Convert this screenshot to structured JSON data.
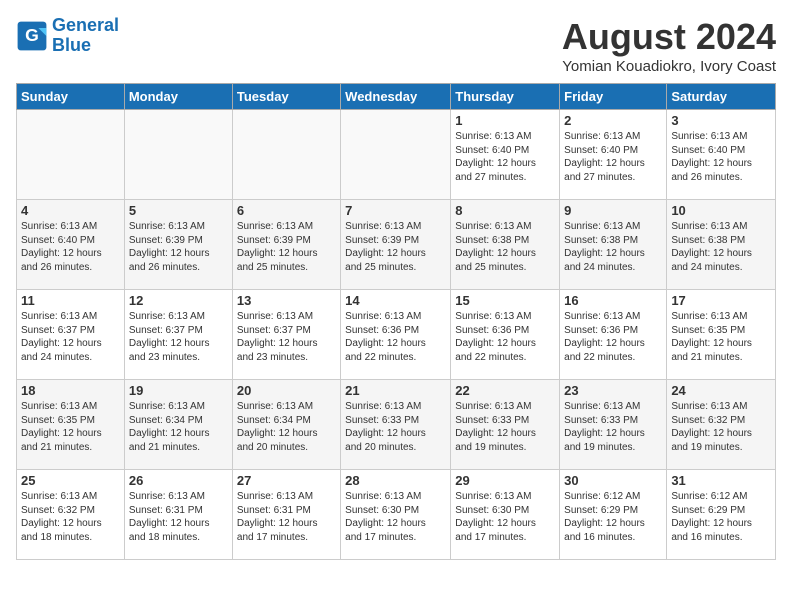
{
  "header": {
    "logo_line1": "General",
    "logo_line2": "Blue",
    "month_year": "August 2024",
    "location": "Yomian Kouadiokro, Ivory Coast"
  },
  "weekdays": [
    "Sunday",
    "Monday",
    "Tuesday",
    "Wednesday",
    "Thursday",
    "Friday",
    "Saturday"
  ],
  "weeks": [
    [
      {
        "day": "",
        "info": ""
      },
      {
        "day": "",
        "info": ""
      },
      {
        "day": "",
        "info": ""
      },
      {
        "day": "",
        "info": ""
      },
      {
        "day": "1",
        "info": "Sunrise: 6:13 AM\nSunset: 6:40 PM\nDaylight: 12 hours\nand 27 minutes."
      },
      {
        "day": "2",
        "info": "Sunrise: 6:13 AM\nSunset: 6:40 PM\nDaylight: 12 hours\nand 27 minutes."
      },
      {
        "day": "3",
        "info": "Sunrise: 6:13 AM\nSunset: 6:40 PM\nDaylight: 12 hours\nand 26 minutes."
      }
    ],
    [
      {
        "day": "4",
        "info": "Sunrise: 6:13 AM\nSunset: 6:40 PM\nDaylight: 12 hours\nand 26 minutes."
      },
      {
        "day": "5",
        "info": "Sunrise: 6:13 AM\nSunset: 6:39 PM\nDaylight: 12 hours\nand 26 minutes."
      },
      {
        "day": "6",
        "info": "Sunrise: 6:13 AM\nSunset: 6:39 PM\nDaylight: 12 hours\nand 25 minutes."
      },
      {
        "day": "7",
        "info": "Sunrise: 6:13 AM\nSunset: 6:39 PM\nDaylight: 12 hours\nand 25 minutes."
      },
      {
        "day": "8",
        "info": "Sunrise: 6:13 AM\nSunset: 6:38 PM\nDaylight: 12 hours\nand 25 minutes."
      },
      {
        "day": "9",
        "info": "Sunrise: 6:13 AM\nSunset: 6:38 PM\nDaylight: 12 hours\nand 24 minutes."
      },
      {
        "day": "10",
        "info": "Sunrise: 6:13 AM\nSunset: 6:38 PM\nDaylight: 12 hours\nand 24 minutes."
      }
    ],
    [
      {
        "day": "11",
        "info": "Sunrise: 6:13 AM\nSunset: 6:37 PM\nDaylight: 12 hours\nand 24 minutes."
      },
      {
        "day": "12",
        "info": "Sunrise: 6:13 AM\nSunset: 6:37 PM\nDaylight: 12 hours\nand 23 minutes."
      },
      {
        "day": "13",
        "info": "Sunrise: 6:13 AM\nSunset: 6:37 PM\nDaylight: 12 hours\nand 23 minutes."
      },
      {
        "day": "14",
        "info": "Sunrise: 6:13 AM\nSunset: 6:36 PM\nDaylight: 12 hours\nand 22 minutes."
      },
      {
        "day": "15",
        "info": "Sunrise: 6:13 AM\nSunset: 6:36 PM\nDaylight: 12 hours\nand 22 minutes."
      },
      {
        "day": "16",
        "info": "Sunrise: 6:13 AM\nSunset: 6:36 PM\nDaylight: 12 hours\nand 22 minutes."
      },
      {
        "day": "17",
        "info": "Sunrise: 6:13 AM\nSunset: 6:35 PM\nDaylight: 12 hours\nand 21 minutes."
      }
    ],
    [
      {
        "day": "18",
        "info": "Sunrise: 6:13 AM\nSunset: 6:35 PM\nDaylight: 12 hours\nand 21 minutes."
      },
      {
        "day": "19",
        "info": "Sunrise: 6:13 AM\nSunset: 6:34 PM\nDaylight: 12 hours\nand 21 minutes."
      },
      {
        "day": "20",
        "info": "Sunrise: 6:13 AM\nSunset: 6:34 PM\nDaylight: 12 hours\nand 20 minutes."
      },
      {
        "day": "21",
        "info": "Sunrise: 6:13 AM\nSunset: 6:33 PM\nDaylight: 12 hours\nand 20 minutes."
      },
      {
        "day": "22",
        "info": "Sunrise: 6:13 AM\nSunset: 6:33 PM\nDaylight: 12 hours\nand 19 minutes."
      },
      {
        "day": "23",
        "info": "Sunrise: 6:13 AM\nSunset: 6:33 PM\nDaylight: 12 hours\nand 19 minutes."
      },
      {
        "day": "24",
        "info": "Sunrise: 6:13 AM\nSunset: 6:32 PM\nDaylight: 12 hours\nand 19 minutes."
      }
    ],
    [
      {
        "day": "25",
        "info": "Sunrise: 6:13 AM\nSunset: 6:32 PM\nDaylight: 12 hours\nand 18 minutes."
      },
      {
        "day": "26",
        "info": "Sunrise: 6:13 AM\nSunset: 6:31 PM\nDaylight: 12 hours\nand 18 minutes."
      },
      {
        "day": "27",
        "info": "Sunrise: 6:13 AM\nSunset: 6:31 PM\nDaylight: 12 hours\nand 17 minutes."
      },
      {
        "day": "28",
        "info": "Sunrise: 6:13 AM\nSunset: 6:30 PM\nDaylight: 12 hours\nand 17 minutes."
      },
      {
        "day": "29",
        "info": "Sunrise: 6:13 AM\nSunset: 6:30 PM\nDaylight: 12 hours\nand 17 minutes."
      },
      {
        "day": "30",
        "info": "Sunrise: 6:12 AM\nSunset: 6:29 PM\nDaylight: 12 hours\nand 16 minutes."
      },
      {
        "day": "31",
        "info": "Sunrise: 6:12 AM\nSunset: 6:29 PM\nDaylight: 12 hours\nand 16 minutes."
      }
    ]
  ]
}
